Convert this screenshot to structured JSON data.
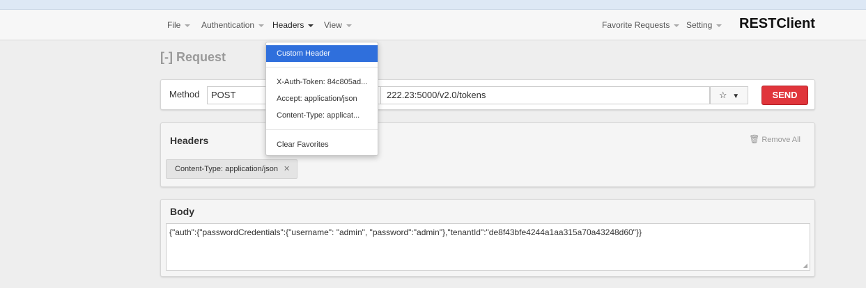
{
  "menu": {
    "file": "File",
    "authentication": "Authentication",
    "headers": "Headers",
    "view": "View",
    "favorite_requests": "Favorite Requests",
    "setting": "Setting",
    "brand": "RESTClient"
  },
  "headers_dropdown": {
    "custom_header": "Custom Header",
    "items": [
      "X-Auth-Token: 84c805ad...",
      "Accept: application/json",
      "Content-Type: applicat..."
    ],
    "clear_favorites": "Clear Favorites"
  },
  "request": {
    "title": "[-] Request",
    "method_label": "Method",
    "method_value": "POST",
    "url_value": "222.23:5000/v2.0/tokens",
    "send_label": "SEND"
  },
  "headers_panel": {
    "title": "Headers",
    "remove_all": "Remove All",
    "tags": [
      {
        "text": "Content-Type: application/json"
      }
    ]
  },
  "body_panel": {
    "title": "Body",
    "content": "{\"auth\":{\"passwordCredentials\":{\"username\": \"admin\", \"password\":\"admin\"},\"tenantId\":\"de8f43bfe4244a1aa315a70a43248d60\"}}"
  },
  "icons": {
    "star": "star-icon",
    "chevron": "chevron-down-icon",
    "trash": "trash-icon",
    "close": "close-icon"
  },
  "colors": {
    "accent": "#2f6fdc",
    "send": "#e0353b"
  }
}
